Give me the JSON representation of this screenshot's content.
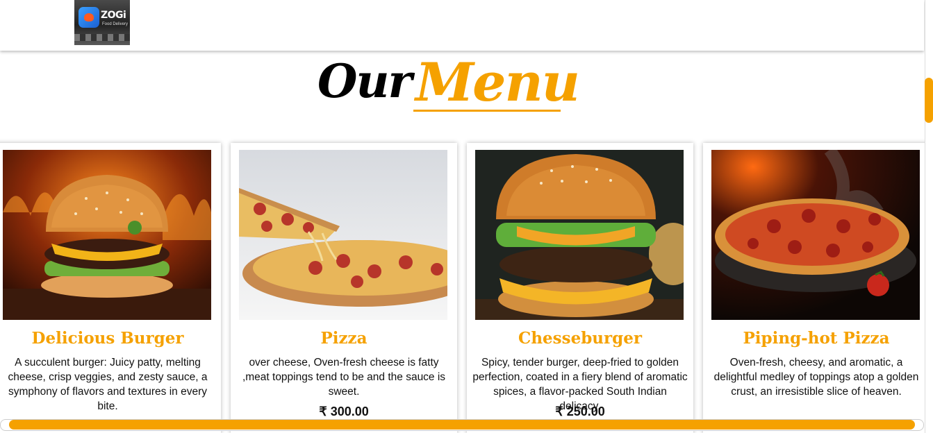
{
  "logo": {
    "brand": "ZOGi",
    "tag": "Food Delivery"
  },
  "heading": {
    "word1": "Our",
    "word2": "Menu"
  },
  "menu": [
    {
      "title": "Delicious Burger",
      "description": "A succulent burger: Juicy patty, melting cheese, crisp veggies, and zesty sauce, a symphony of flavors and textures in every bite.",
      "price": ""
    },
    {
      "title": "Pizza",
      "description": "over cheese, Oven-fresh cheese is fatty ,meat toppings tend to be and the sauce is sweet.",
      "price": "₹ 300.00"
    },
    {
      "title": "Chesseburger",
      "description": "Spicy, tender burger, deep-fried to golden perfection, coated in a fiery blend of aromatic spices, a flavor-packed South Indian delicacy.",
      "price": "₹ 250.00"
    },
    {
      "title": "Piping-hot Pizza",
      "description": "Oven-fresh, cheesy, and aromatic, a delightful medley of toppings atop a golden crust, an irresistible slice of heaven.",
      "price": ""
    }
  ],
  "colors": {
    "accent": "#f5a100",
    "text": "#111111"
  }
}
